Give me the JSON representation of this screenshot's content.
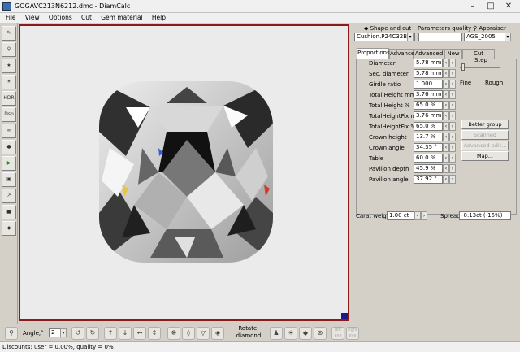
{
  "window": {
    "title": "GOGAVC213N6212.dmc - DiamCalc"
  },
  "menu": [
    "File",
    "View",
    "Options",
    "Cut",
    "Gem material",
    "Help"
  ],
  "panel_tabs_top": {
    "shape": "Shape and cut",
    "params": "Parameters quality",
    "appraiser": "Appraiser"
  },
  "shape_select": "Cushion.P24C32B",
  "grade_select": "AGS_2005",
  "tabs": [
    "Proportions",
    "Advanced",
    "Advanced 2",
    "New",
    "Cut Quality"
  ],
  "step": {
    "label": "Step",
    "fine": "Fine",
    "rough": "Rough"
  },
  "params": [
    {
      "label": "Diameter",
      "value": "5.78 mm"
    },
    {
      "label": "Sec. diameter",
      "value": "5.78 mm"
    },
    {
      "label": "Girdle ratio",
      "value": "1.000"
    },
    {
      "label": "Total Height mm",
      "value": "3.76 mm"
    },
    {
      "label": "Total Height %",
      "value": "65.0 %"
    },
    {
      "label": "TotalHeightFix mm",
      "value": "3.76 mm"
    },
    {
      "label": "TotalHeightFix %",
      "value": "65.0 %"
    },
    {
      "label": "Crown height",
      "value": "13.7 %"
    },
    {
      "label": "Crown angle",
      "value": "34.35 °"
    },
    {
      "label": "Table",
      "value": "60.0 %"
    },
    {
      "label": "Pavilion depth",
      "value": "45.9 %"
    },
    {
      "label": "Pavilion angle",
      "value": "37.92 °"
    }
  ],
  "buttons": {
    "better_group": "Better group",
    "scanned_reports": "Scanned reports...",
    "advanced_edit": "Advanced edit...",
    "map": "Map..."
  },
  "carat": {
    "label": "Carat weight",
    "value": "1.00 ct"
  },
  "spread": {
    "label": "Spread",
    "value": "-0.13ct (-15%)"
  },
  "bottom": {
    "angle_label": "Angle,°",
    "angle_value": "2",
    "rotate_label": "Rotate:",
    "rotate_value": "diamond",
    "left_eye": "left eye",
    "right_eye": "right eye"
  },
  "status": "Discounts: user = 0.00%, quality = 0%"
}
